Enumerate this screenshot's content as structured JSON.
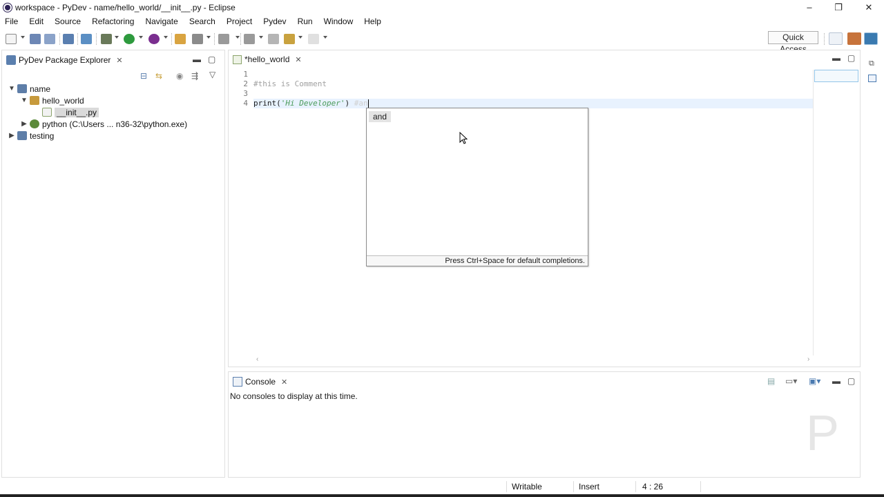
{
  "window": {
    "title": "workspace - PyDev - name/hello_world/__init__.py - Eclipse",
    "minimize": "–",
    "restore": "❐",
    "close": "✕"
  },
  "menu": [
    "File",
    "Edit",
    "Source",
    "Refactoring",
    "Navigate",
    "Search",
    "Project",
    "Pydev",
    "Run",
    "Window",
    "Help"
  ],
  "toolbar": {
    "quick_access": "Quick Access"
  },
  "explorer": {
    "tab_label": "PyDev Package Explorer",
    "tree": [
      {
        "label": "name",
        "depth": 0,
        "expanded": true,
        "icon": "project-icon"
      },
      {
        "label": "hello_world",
        "depth": 1,
        "expanded": true,
        "icon": "package-icon"
      },
      {
        "label": "__init__.py",
        "depth": 2,
        "selected": true,
        "icon": "python-file-icon"
      },
      {
        "label": "python  (C:\\Users ... n36-32\\python.exe)",
        "depth": 1,
        "expanded": false,
        "icon": "interpreter-icon"
      },
      {
        "label": "testing",
        "depth": 0,
        "expanded": false,
        "icon": "project-icon"
      }
    ]
  },
  "editor": {
    "tab_label": "*hello_world",
    "line_numbers": [
      "1",
      "2",
      "3",
      "4"
    ],
    "lines": {
      "l2_comment": "#this is Comment",
      "l4_func": "print(",
      "l4_str": "'Hi Developer'",
      "l4_close": ") ",
      "l4_comment": "#an"
    }
  },
  "completion": {
    "item": "and",
    "hint": "Press Ctrl+Space for default completions."
  },
  "console": {
    "tab_label": "Console",
    "message": "No consoles to display at this time.",
    "watermark": "P"
  },
  "status": {
    "writable": "Writable",
    "insert": "Insert",
    "position": "4 : 26"
  },
  "colors": {
    "accent_selection": "#dadada",
    "current_line": "#e8f2fe",
    "string": "#4b9b5a",
    "comment": "#a0a0a0"
  }
}
